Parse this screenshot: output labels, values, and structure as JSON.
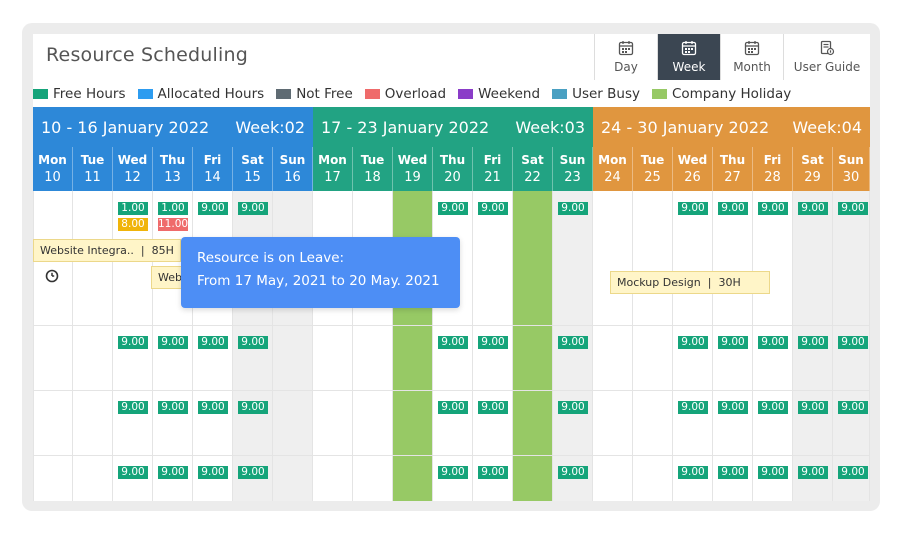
{
  "header": {
    "title": "Resource Scheduling",
    "views": [
      {
        "label": "Day",
        "icon": "calendar-icon",
        "active": false
      },
      {
        "label": "Week",
        "icon": "calendar-icon",
        "active": true
      },
      {
        "label": "Month",
        "icon": "calendar-icon",
        "active": false
      },
      {
        "label": "User Guide",
        "icon": "guide-icon",
        "active": false
      }
    ]
  },
  "legend": [
    {
      "label": "Free Hours",
      "color": "#15a47a"
    },
    {
      "label": "Allocated Hours",
      "color": "#2d9cf0"
    },
    {
      "label": "Not Free",
      "color": "#5f6b73"
    },
    {
      "label": "Overload",
      "color": "#ef6b6b"
    },
    {
      "label": "Weekend",
      "color": "#8a3cc8"
    },
    {
      "label": "User Busy",
      "color": "#4aa0c2"
    },
    {
      "label": "Company Holiday",
      "color": "#97c965"
    }
  ],
  "weeks": [
    {
      "range": "10 - 16 January 2022",
      "week": "Week:02",
      "color": "#2d88d8"
    },
    {
      "range": "17 - 23 January 2022",
      "week": "Week:03",
      "color": "#22a383"
    },
    {
      "range": "24 - 30 January 2022",
      "week": "Week:04",
      "color": "#e0963f"
    }
  ],
  "days": [
    {
      "name": "Mon",
      "date": "10"
    },
    {
      "name": "Tue",
      "date": "11"
    },
    {
      "name": "Wed",
      "date": "12"
    },
    {
      "name": "Thu",
      "date": "13"
    },
    {
      "name": "Fri",
      "date": "14"
    },
    {
      "name": "Sat",
      "date": "15"
    },
    {
      "name": "Sun",
      "date": "16"
    },
    {
      "name": "Mon",
      "date": "17"
    },
    {
      "name": "Tue",
      "date": "18"
    },
    {
      "name": "Wed",
      "date": "19"
    },
    {
      "name": "Thu",
      "date": "20"
    },
    {
      "name": "Fri",
      "date": "21"
    },
    {
      "name": "Sat",
      "date": "22"
    },
    {
      "name": "Sun",
      "date": "23"
    },
    {
      "name": "Mon",
      "date": "24"
    },
    {
      "name": "Tue",
      "date": "25"
    },
    {
      "name": "Wed",
      "date": "26"
    },
    {
      "name": "Thu",
      "date": "27"
    },
    {
      "name": "Fri",
      "date": "28"
    },
    {
      "name": "Sat",
      "date": "29"
    },
    {
      "name": "Sun",
      "date": "30"
    }
  ],
  "hours": {
    "free": "9.00",
    "allocated_a": "1.00",
    "allocated_b": "8.00",
    "overload": "11.00"
  },
  "tasks": [
    {
      "label": "Website Integra..",
      "sep": "|",
      "hours": "85H"
    },
    {
      "label": "Web",
      "sep": "",
      "hours": ""
    },
    {
      "label": "Mockup Design",
      "sep": "|",
      "hours": "30H"
    }
  ],
  "tooltip": {
    "line1": "Resource is on Leave:",
    "line2": "From 17 May, 2021 to 20 May. 2021"
  }
}
